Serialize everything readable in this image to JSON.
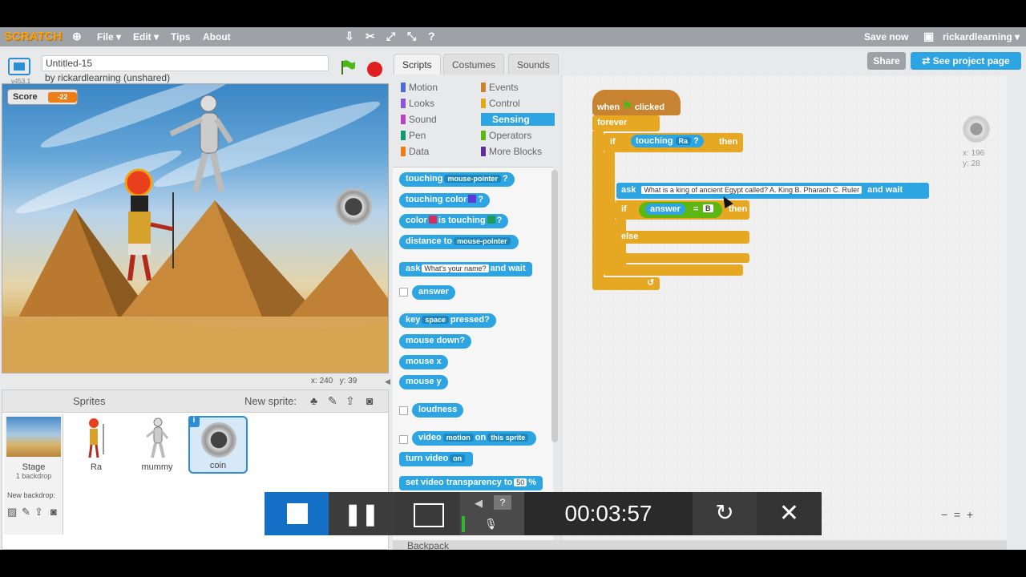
{
  "menubar": {
    "logo": "SCRATCH",
    "file": "File",
    "edit": "Edit",
    "tips": "Tips",
    "about": "About",
    "save_now": "Save now",
    "user": "rickardlearning",
    "file_caret": "▾",
    "edit_caret": "▾",
    "user_caret": "▾"
  },
  "project": {
    "title": "Untitled-15",
    "byline": "by rickardlearning (unshared)",
    "version": "v453.1"
  },
  "stage": {
    "score_label": "Score",
    "score_value": "-22",
    "coords_x_label": "x:",
    "coords_x": "240",
    "coords_y_label": "y:",
    "coords_y": "39"
  },
  "sprites": {
    "title": "Sprites",
    "new_sprite": "New sprite:",
    "stage_label": "Stage",
    "backdrop_count": "1 backdrop",
    "new_backdrop": "New backdrop:",
    "items": [
      {
        "name": "Ra"
      },
      {
        "name": "mummy"
      },
      {
        "name": "coin"
      }
    ],
    "info": "i"
  },
  "tabs": [
    {
      "label": "Scripts"
    },
    {
      "label": "Costumes"
    },
    {
      "label": "Sounds"
    }
  ],
  "topright": {
    "share": "Share",
    "project_page": "See project page"
  },
  "categories": [
    {
      "label": "Motion",
      "color": "#4a6cd4"
    },
    {
      "label": "Looks",
      "color": "#8a55d7"
    },
    {
      "label": "Sound",
      "color": "#bb42c3"
    },
    {
      "label": "Pen",
      "color": "#0e9a6c"
    },
    {
      "label": "Data",
      "color": "#ee7d16"
    },
    {
      "label": "Events",
      "color": "#c88330"
    },
    {
      "label": "Control",
      "color": "#e1a91a"
    },
    {
      "label": "Sensing",
      "color": "#2ca5e2"
    },
    {
      "label": "Operators",
      "color": "#5cb712"
    },
    {
      "label": "More Blocks",
      "color": "#632d99"
    }
  ],
  "palette_blocks": {
    "touching": "touching",
    "touching_dd": "mouse-pointer",
    "q": "?",
    "touching_color": "touching color",
    "color": "color",
    "is_touching": "is touching",
    "distance_to": "distance to",
    "distance_dd": "mouse-pointer",
    "ask": "ask",
    "ask_input": "What's your name?",
    "and_wait": "and wait",
    "answer": "answer",
    "key": "key",
    "key_dd": "space",
    "pressed": "pressed?",
    "mouse_down": "mouse down?",
    "mouse_x": "mouse x",
    "mouse_y": "mouse y",
    "loudness": "loudness",
    "video": "video",
    "video_dd": "motion",
    "on": "on",
    "video_target": "this sprite",
    "turn_video": "turn video",
    "turn_video_dd": "on",
    "set_transparency": "set video transparency to",
    "transparency_val": "50",
    "percent": "%"
  },
  "script": {
    "when": "when",
    "clicked": "clicked",
    "forever": "forever",
    "if": "if",
    "touching": "touching",
    "touching_target": "Ra",
    "q": "?",
    "then": "then",
    "ask": "ask",
    "question": "What is a king of ancient Egypt called? A. King B. Pharaoh C. Ruler",
    "and_wait": "and wait",
    "if2": "if",
    "answer": "answer",
    "eq": "=",
    "answer_val": "B",
    "then2": "then",
    "else": "else",
    "loop_arrow": "↺"
  },
  "sprite_info": {
    "x_label": "x:",
    "x": "196",
    "y_label": "y:",
    "y": "28"
  },
  "zoom": {
    "out": "−",
    "reset": "=",
    "in": "+"
  },
  "backpack": "Backpack",
  "recorder": {
    "time": "00:03:57",
    "pause": "❚❚",
    "redo": "↻",
    "close": "✕",
    "speaker": "◀",
    "question": "?",
    "mic": "🎙"
  },
  "colors": {
    "sensing": "#2ca5e2",
    "control": "#e6a822",
    "events": "#c88330",
    "accent": "#1470c4"
  }
}
